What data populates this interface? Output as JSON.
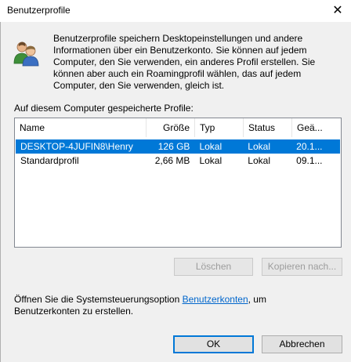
{
  "window": {
    "title": "Benutzerprofile",
    "close_glyph": "✕"
  },
  "intro_text": "Benutzerprofile speichern Desktopeinstellungen und andere Informationen über ein Benutzerkonto. Sie können auf jedem Computer, den Sie verwenden, ein anderes Profil erstellen. Sie können aber auch ein Roamingprofil wählen, das auf jedem Computer, den Sie verwenden, gleich ist.",
  "section_label": "Auf diesem Computer gespeicherte Profile:",
  "table": {
    "columns": [
      "Name",
      "Größe",
      "Typ",
      "Status",
      "Geä..."
    ],
    "rows": [
      {
        "name": "DESKTOP-4JUFIN8\\Henry",
        "size": "126 GB",
        "type": "Lokal",
        "status": "Lokal",
        "changed": "20.1...",
        "selected": true
      },
      {
        "name": "Standardprofil",
        "size": "2,66 MB",
        "type": "Lokal",
        "status": "Lokal",
        "changed": "09.1...",
        "selected": false
      }
    ]
  },
  "buttons": {
    "delete": "Löschen",
    "copy": "Kopieren nach...",
    "ok": "OK",
    "cancel": "Abbrechen"
  },
  "footer": {
    "before": "Öffnen Sie die Systemsteuerungsoption ",
    "link": "Benutzerkonten",
    "after": ", um Benutzerkonten zu erstellen."
  },
  "colors": {
    "selection": "#0078d7",
    "link": "#0066cc",
    "dialog_bg": "#f0f0f0"
  },
  "icons": {
    "header_icon": "users-icon"
  }
}
